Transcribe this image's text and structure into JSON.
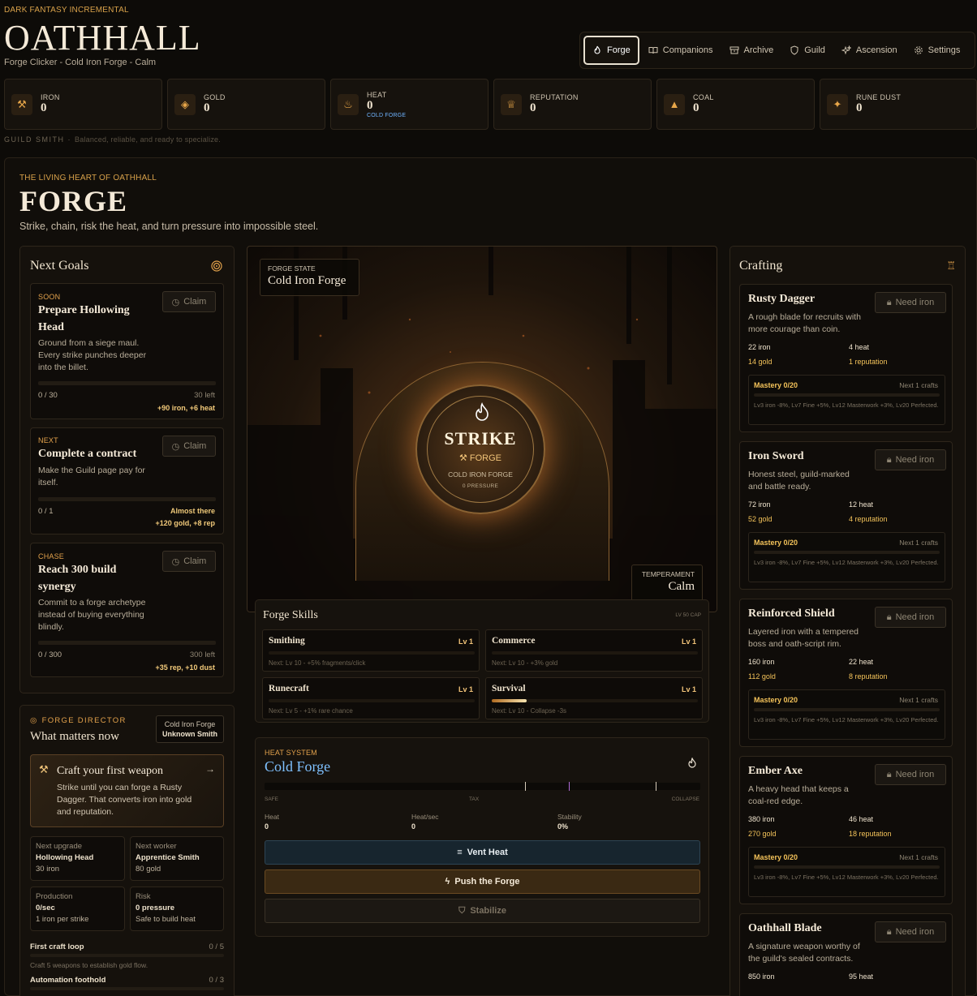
{
  "header": {
    "kicker": "DARK FANTASY INCREMENTAL",
    "title": "OATHHALL",
    "subtitle": "Forge Clicker - Cold Iron Forge - Calm"
  },
  "nav": [
    {
      "label": "Forge",
      "icon": "flame-icon",
      "active": true
    },
    {
      "label": "Companions",
      "icon": "book-icon"
    },
    {
      "label": "Archive",
      "icon": "archive-icon"
    },
    {
      "label": "Guild",
      "icon": "shield-icon"
    },
    {
      "label": "Ascension",
      "icon": "sparkles-icon"
    },
    {
      "label": "Settings",
      "icon": "gear-icon"
    }
  ],
  "resources": [
    {
      "label": "IRON",
      "value": "0",
      "icon": "hammer-icon"
    },
    {
      "label": "GOLD",
      "value": "0",
      "icon": "gem-icon"
    },
    {
      "label": "HEAT",
      "value": "0",
      "icon": "flame-icon",
      "tag": "COLD FORGE"
    },
    {
      "label": "REPUTATION",
      "value": "0",
      "icon": "trophy-icon"
    },
    {
      "label": "COAL",
      "value": "0",
      "icon": "mountain-icon"
    },
    {
      "label": "RUNE DUST",
      "value": "0",
      "icon": "sparkles-icon"
    }
  ],
  "archetype": {
    "name": "GUILD SMITH",
    "desc": "Balanced, reliable, and ready to specialize."
  },
  "forge_section": {
    "kicker": "THE LIVING HEART OF OATHHALL",
    "title": "FORGE",
    "subtitle": "Strike, chain, risk the heat, and turn pressure into impossible steel."
  },
  "goals": {
    "title": "Next Goals",
    "items": [
      {
        "tag": "SOON",
        "title_l1": "Prepare Hollowing",
        "title_l2": "Head",
        "desc": "Ground from a siege maul. Every strike punches deeper into the billet.",
        "claim": "Claim",
        "progress": "0 / 30",
        "left": "30 left",
        "reward": "+90 iron, +6 heat"
      },
      {
        "tag": "NEXT",
        "title_l1": "Complete a contract",
        "title_l2": "",
        "desc": "Make the Guild page pay for itself.",
        "claim": "Claim",
        "progress": "0 / 1",
        "left": "Almost there",
        "reward": "+120 gold, +8 rep"
      },
      {
        "tag": "CHASE",
        "title_l1": "Reach 300 build",
        "title_l2": "synergy",
        "desc": "Commit to a forge archetype instead of buying everything blindly.",
        "claim": "Claim",
        "progress": "0 / 300",
        "left": "300 left",
        "reward": "+35 rep, +10 dust"
      }
    ]
  },
  "director": {
    "kicker": "FORGE DIRECTOR",
    "title": "What matters now",
    "badge_l1": "Cold Iron Forge",
    "badge_l2": "Unknown Smith",
    "main_title": "Craft your first weapon",
    "main_desc": "Strike until you can forge a Rusty Dagger. That converts iron into gold and reputation.",
    "stats": [
      {
        "label": "Next upgrade",
        "value": "Hollowing Head",
        "sub": "30 iron"
      },
      {
        "label": "Next worker",
        "value": "Apprentice Smith",
        "sub": "80 gold"
      },
      {
        "label": "Production",
        "value": "0/sec",
        "sub": "1 iron per strike"
      },
      {
        "label": "Risk",
        "value": "0 pressure",
        "sub": "Safe to build heat"
      }
    ],
    "loops": [
      {
        "label": "First craft loop",
        "count": "0 / 5",
        "desc": "Craft 5 weapons to establish gold flow."
      },
      {
        "label": "Automation foothold",
        "count": "0 / 3",
        "desc": ""
      }
    ]
  },
  "forge": {
    "state_label": "FORGE STATE",
    "state_value": "Cold Iron Forge",
    "strike": "STRIKE",
    "strike_sub": "FORGE",
    "forge_name": "COLD IRON FORGE",
    "pressure": "0 PRESSURE",
    "temper_label": "TEMPERAMENT",
    "temper_value": "Calm"
  },
  "skills": {
    "title": "Forge Skills",
    "cap": "LV 50 CAP",
    "items": [
      {
        "name": "Smithing",
        "lvl": "Lv 1",
        "next": "Next: Lv 10 - +5% fragments/click",
        "progress": 0
      },
      {
        "name": "Commerce",
        "lvl": "Lv 1",
        "next": "Next: Lv 10 - +3% gold",
        "progress": 0
      },
      {
        "name": "Runecraft",
        "lvl": "Lv 1",
        "next": "Next: Lv 5 - +1% rare chance",
        "progress": 0
      },
      {
        "name": "Survival",
        "lvl": "Lv 1",
        "next": "Next: Lv 10 - Collapse -3s",
        "progress": 0.17
      }
    ]
  },
  "heat": {
    "kicker": "HEAT SYSTEM",
    "title": "Cold Forge",
    "safe": "SAFE",
    "tax": "TAX",
    "collapse": "COLLAPSE",
    "stats": [
      {
        "label": "Heat",
        "value": "0"
      },
      {
        "label": "Heat/sec",
        "value": "0"
      },
      {
        "label": "Stability",
        "value": "0%"
      }
    ],
    "vent": "Vent Heat",
    "push": "Push the Forge",
    "stabilize": "Stabilize"
  },
  "crafting": {
    "title": "Crafting",
    "items": [
      {
        "name": "Rusty Dagger",
        "desc": "A rough blade for recruits with more courage than coin.",
        "btn": "Need iron",
        "c1": "22 iron",
        "c2": "4 heat",
        "c3": "14 gold",
        "c4": "1 reputation",
        "mastery": "Mastery 0/20",
        "next": "Next 1 crafts",
        "bonus": "Lv3 iron -8%, Lv7 Fine +5%, Lv12 Masterwork +3%, Lv20 Perfected."
      },
      {
        "name": "Iron Sword",
        "desc": "Honest steel, guild-marked and battle ready.",
        "btn": "Need iron",
        "c1": "72 iron",
        "c2": "12 heat",
        "c3": "52 gold",
        "c4": "4 reputation",
        "mastery": "Mastery 0/20",
        "next": "Next 1 crafts",
        "bonus": "Lv3 iron -8%, Lv7 Fine +5%, Lv12 Masterwork +3%, Lv20 Perfected."
      },
      {
        "name": "Reinforced Shield",
        "desc": "Layered iron with a tempered boss and oath-script rim.",
        "btn": "Need iron",
        "c1": "160 iron",
        "c2": "22 heat",
        "c3": "112 gold",
        "c4": "8 reputation",
        "mastery": "Mastery 0/20",
        "next": "Next 1 crafts",
        "bonus": "Lv3 iron -8%, Lv7 Fine +5%, Lv12 Masterwork +3%, Lv20 Perfected."
      },
      {
        "name": "Ember Axe",
        "desc": "A heavy head that keeps a coal-red edge.",
        "btn": "Need iron",
        "c1": "380 iron",
        "c2": "46 heat",
        "c3": "270 gold",
        "c4": "18 reputation",
        "mastery": "Mastery 0/20",
        "next": "Next 1 crafts",
        "bonus": "Lv3 iron -8%, Lv7 Fine +5%, Lv12 Masterwork +3%, Lv20 Perfected."
      },
      {
        "name": "Oathhall Blade",
        "desc": "A signature weapon worthy of the guild's sealed contracts.",
        "btn": "Need iron",
        "c1": "850 iron",
        "c2": "95 heat",
        "c3": "",
        "c4": "",
        "mastery": "",
        "next": "",
        "bonus": ""
      }
    ]
  }
}
